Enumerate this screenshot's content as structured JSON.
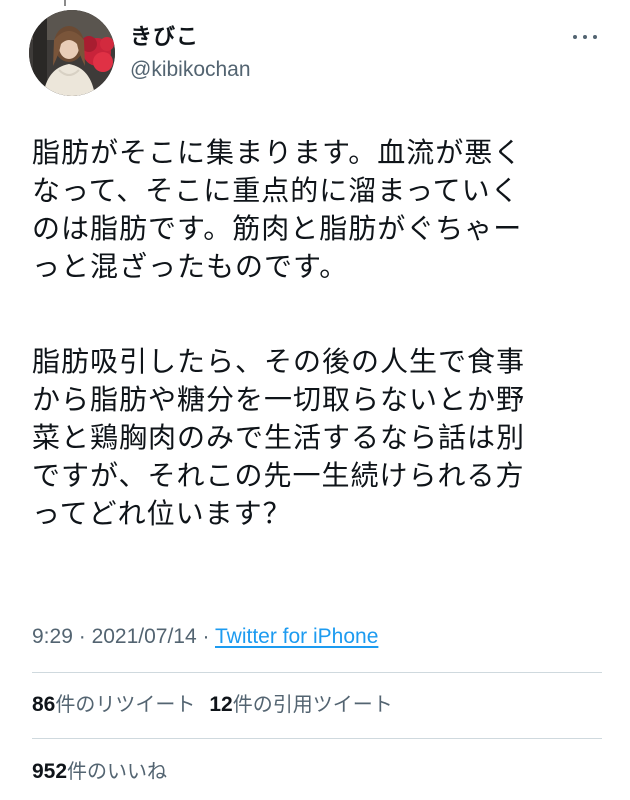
{
  "user": {
    "display_name": "きびこ",
    "handle": "@kibikochan"
  },
  "tweet": {
    "paragraphs": [
      "脂肪がそこに集まります。血流が悪く\nなって、そこに重点的に溜まっていく\nのは脂肪です。筋肉と脂肪がぐちゃー\nっと混ざったものです。",
      "脂肪吸引したら、その後の人生で食事\nから脂肪や糖分を一切取らないとか野\n菜と鶏胸肉のみで生活するなら話は別\nですが、それこの先一生続けられる方\nってどれ位います？"
    ],
    "time": "9:29",
    "separator": "·",
    "date": "2021/07/14",
    "source": "Twitter for iPhone"
  },
  "stats": {
    "retweets_count": "86",
    "retweets_label": "件のリツイート",
    "quotes_count": "12",
    "quotes_label": "件の引用ツイート",
    "likes_count": "952",
    "likes_label": "件のいいね"
  },
  "icons": {
    "more": "more-horizontal-icon"
  },
  "colors": {
    "text_primary": "#0f1419",
    "text_secondary": "#536471",
    "link": "#1d9bf0",
    "divider": "#cfd9de"
  }
}
